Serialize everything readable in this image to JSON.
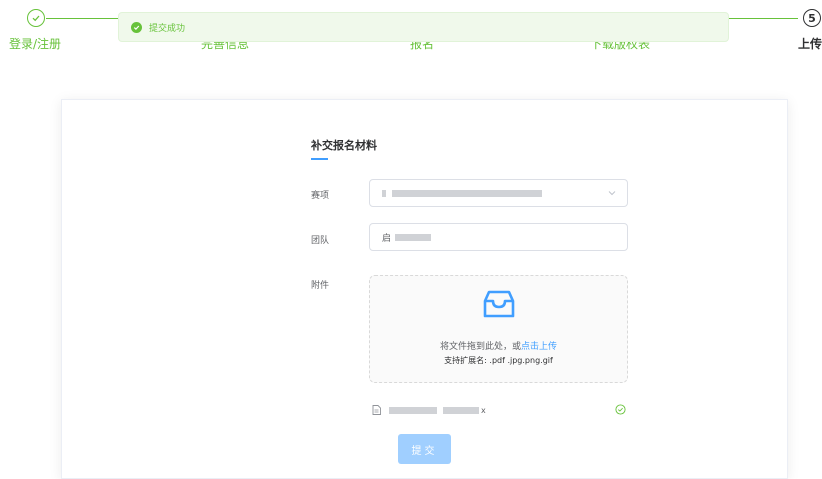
{
  "steps": [
    {
      "title": "登录/注册",
      "status": "done"
    },
    {
      "title": "完善信息",
      "status": "done"
    },
    {
      "title": "报名",
      "status": "done"
    },
    {
      "title": "下载版权表",
      "status": "done"
    },
    {
      "title": "上传",
      "status": "current",
      "number": "5"
    }
  ],
  "toast": {
    "message": "提交成功",
    "type": "success"
  },
  "form": {
    "section_title": "补交报名材料",
    "event_label": "赛项",
    "team_label": "团队",
    "team_value_prefix": "启",
    "attachment_label": "附件",
    "upload": {
      "drag_text": "将文件拖到此处，或",
      "click_text": "点击上传",
      "tip": "支持扩展名: .pdf .jpg.png.gif"
    },
    "file": {
      "name_suffix": "x",
      "status": "success"
    },
    "submit_label": "提交"
  },
  "colors": {
    "success": "#67c23a",
    "primary": "#409eff",
    "primary_disabled": "#a0cfff"
  }
}
